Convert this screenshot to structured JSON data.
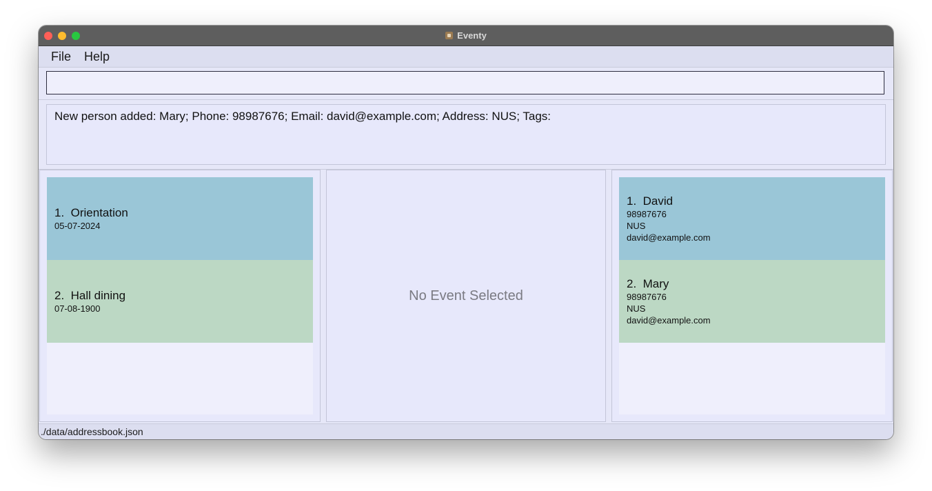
{
  "window": {
    "title": "Eventy"
  },
  "menu": {
    "items": [
      "File",
      "Help"
    ]
  },
  "command": {
    "value": "",
    "placeholder": ""
  },
  "result": {
    "text": "New person added: Mary; Phone: 98987676; Email: david@example.com; Address: NUS; Tags:"
  },
  "events": [
    {
      "index": "1.",
      "name": "Orientation",
      "date": "05-07-2024"
    },
    {
      "index": "2.",
      "name": "Hall dining",
      "date": "07-08-1900"
    }
  ],
  "event_detail": {
    "placeholder": "No Event Selected"
  },
  "persons": [
    {
      "index": "1.",
      "name": "David",
      "phone": "98987676",
      "address": "NUS",
      "email": "david@example.com"
    },
    {
      "index": "2.",
      "name": "Mary",
      "phone": "98987676",
      "address": "NUS",
      "email": "david@example.com"
    }
  ],
  "status": {
    "path": "./data/addressbook.json"
  },
  "colors": {
    "card_odd": "#9ac6d7",
    "card_even": "#bcd8c4",
    "background": "#e6e7f8"
  },
  "icons": {
    "app": "app-icon"
  }
}
